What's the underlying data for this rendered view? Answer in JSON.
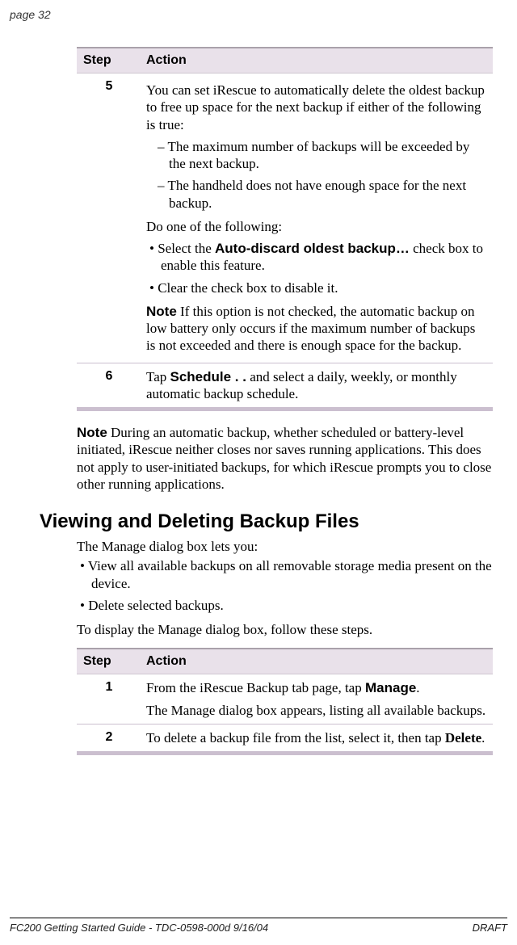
{
  "page_header": "page 32",
  "table1": {
    "head_step": "Step",
    "head_action": "Action",
    "row5": {
      "num": "5",
      "p1": "You can set iRescue to automatically delete the oldest backup to free up space for the next backup if either of the following is true:",
      "d1": "– The maximum number of backups will be exceeded by the next backup.",
      "d2": "– The handheld does not have enough space for the next backup.",
      "p2": "Do one of the following:",
      "b1a": "• Select the ",
      "b1bold": "Auto-discard oldest backup…",
      "b1b": " check box to enable this feature.",
      "b2": "• Clear the check box to disable it.",
      "note_label": "Note",
      "note_body": "  If this option is not checked, the automatic backup on low battery only occurs if the maximum number of backups is not exceeded and there is enough space for the backup."
    },
    "row6": {
      "num": "6",
      "a": "Tap ",
      "bold": "Schedule . .",
      "b": " and select a daily, weekly, or monthly automatic backup schedule."
    }
  },
  "midnote": {
    "label": "Note",
    "body": "  During an automatic backup, whether scheduled or battery-level initiated, iRescue neither closes nor saves running applica­tions. This does not apply to user-initiated backups, for which iRescue prompts you to close other running applications."
  },
  "section_title": "Viewing and Deleting Backup Files",
  "section_intro": "The Manage dialog box lets you:",
  "section_b1": "• View all available backups on all removable storage media present on the device.",
  "section_b2": "• Delete selected backups.",
  "section_p2": "To display the Manage dialog box, follow these steps.",
  "table2": {
    "head_step": "Step",
    "head_action": "Action",
    "row1": {
      "num": "1",
      "a": "From the iRescue Backup tab page, tap ",
      "bold": "Manage",
      "b": ".",
      "p2": "The Manage dialog box appears, listing all available backups."
    },
    "row2": {
      "num": "2",
      "a": "To delete a backup file from the list, select it, then tap ",
      "bold": "Delete",
      "b": "."
    }
  },
  "footer_left": "FC200 Getting Started Guide - TDC-0598-000d   9/16/04",
  "footer_right": "DRAFT"
}
